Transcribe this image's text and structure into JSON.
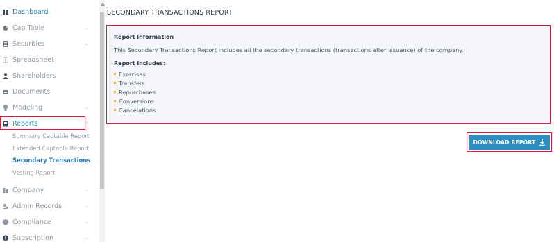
{
  "sidebar": {
    "items": [
      {
        "label": "Dashboard",
        "icon": "dashboard-icon",
        "has_chevron": false
      },
      {
        "label": "Cap Table",
        "icon": "pie-chart-icon",
        "has_chevron": true
      },
      {
        "label": "Securities",
        "icon": "document-icon",
        "has_chevron": true
      },
      {
        "label": "Spreadsheet",
        "icon": "grid-icon",
        "has_chevron": false
      },
      {
        "label": "Shareholders",
        "icon": "person-icon",
        "has_chevron": false
      },
      {
        "label": "Documents",
        "icon": "folder-icon",
        "has_chevron": false
      },
      {
        "label": "Modeling",
        "icon": "lightbulb-icon",
        "has_chevron": true
      },
      {
        "label": "Reports",
        "icon": "report-icon",
        "has_chevron": true
      },
      {
        "label": "Company",
        "icon": "building-icon",
        "has_chevron": true
      },
      {
        "label": "Admin Records",
        "icon": "admin-icon",
        "has_chevron": true
      },
      {
        "label": "Compliance",
        "icon": "shield-icon",
        "has_chevron": true
      },
      {
        "label": "Subscription",
        "icon": "dollar-icon",
        "has_chevron": true
      }
    ],
    "reports_submenu": [
      {
        "label": "Summary Captable Report"
      },
      {
        "label": "Extended Captable Report"
      },
      {
        "label": "Secondary Transactions"
      },
      {
        "label": "Vesting Report"
      }
    ]
  },
  "main": {
    "title": "SECONDARY TRANSACTIONS REPORT",
    "info_heading": "Report information",
    "info_description": "This Secondary Transactions Report includes all the secondary transactions (transactions after issuance) of the company.",
    "includes_heading": "Report includes:",
    "includes": [
      "Exercises",
      "Transfers",
      "Repurchases",
      "Conversions",
      "Cancelations"
    ],
    "download_button": "DOWNLOAD REPORT"
  },
  "colors": {
    "accent": "#2c8dc1",
    "highlight": "#d11f3a",
    "bullet": "#e0a33a"
  }
}
